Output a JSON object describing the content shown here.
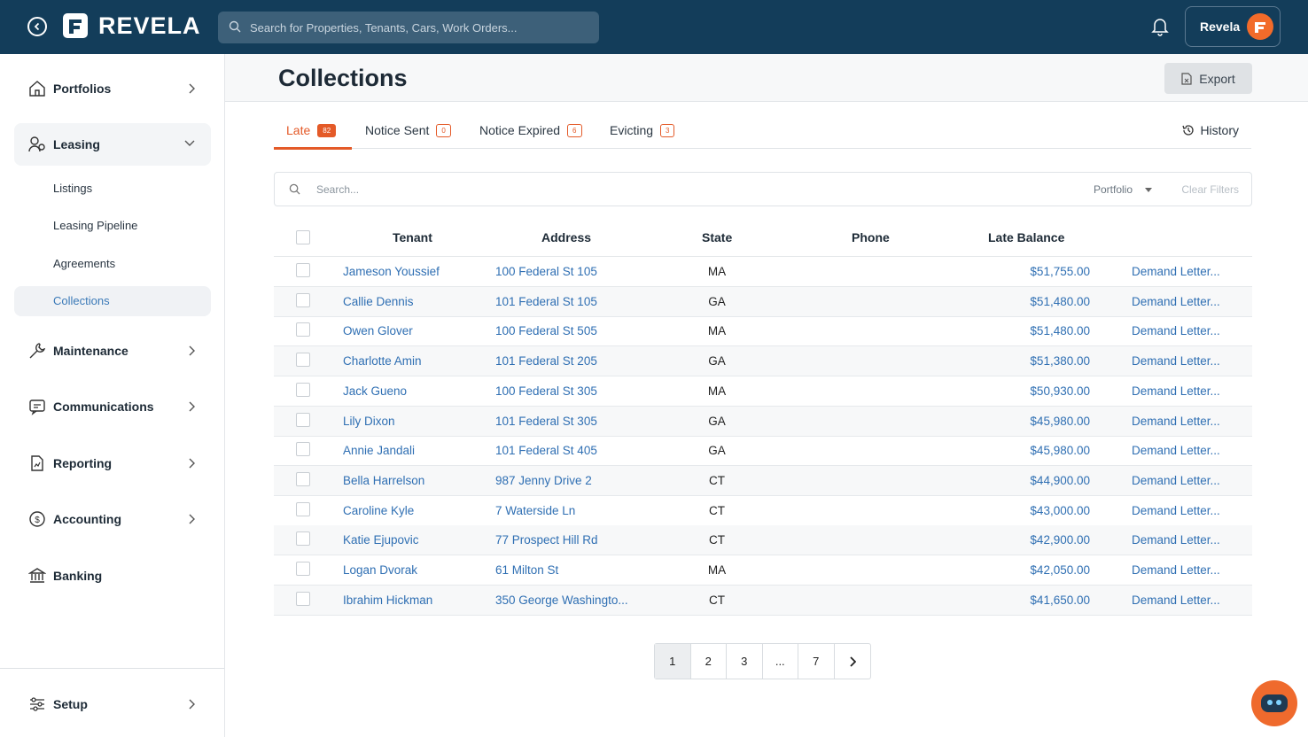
{
  "header": {
    "brand": "REVELA",
    "search_placeholder": "Search for Properties, Tenants, Cars, Work Orders...",
    "account_name": "Revela"
  },
  "sidebar": {
    "items": [
      {
        "label": "Portfolios",
        "icon": "home-icon"
      },
      {
        "label": "Leasing",
        "icon": "users-icon",
        "open": true
      },
      {
        "label": "Maintenance",
        "icon": "wrench-icon"
      },
      {
        "label": "Communications",
        "icon": "chat-icon"
      },
      {
        "label": "Reporting",
        "icon": "report-icon"
      },
      {
        "label": "Accounting",
        "icon": "dollar-icon"
      },
      {
        "label": "Banking",
        "icon": "bank-icon"
      }
    ],
    "leasing_sub": [
      "Listings",
      "Leasing Pipeline",
      "Agreements",
      "Collections"
    ],
    "active_sub": "Collections",
    "setup_label": "Setup"
  },
  "page": {
    "title": "Collections",
    "export_label": "Export",
    "history_label": "History"
  },
  "tabs": [
    {
      "label": "Late",
      "count": "82",
      "active": true
    },
    {
      "label": "Notice Sent",
      "count": "0"
    },
    {
      "label": "Notice Expired",
      "count": "6"
    },
    {
      "label": "Evicting",
      "count": "3"
    }
  ],
  "filters": {
    "search_placeholder": "Search...",
    "portfolio_label": "Portfolio",
    "clear_label": "Clear Filters"
  },
  "table": {
    "headers": [
      "Tenant",
      "Address",
      "State",
      "Phone",
      "Late Balance"
    ],
    "rows": [
      {
        "tenant": "Jameson Youssief",
        "address": "100 Federal St 105",
        "state": "MA",
        "phone": "",
        "balance": "$51,755.00",
        "action": "Demand Letter..."
      },
      {
        "tenant": "Callie Dennis",
        "address": "101 Federal St 105",
        "state": "GA",
        "phone": "",
        "balance": "$51,480.00",
        "action": "Demand Letter..."
      },
      {
        "tenant": "Owen Glover",
        "address": "100 Federal St 505",
        "state": "MA",
        "phone": "",
        "balance": "$51,480.00",
        "action": "Demand Letter..."
      },
      {
        "tenant": "Charlotte Amin",
        "address": "101 Federal St 205",
        "state": "GA",
        "phone": "",
        "balance": "$51,380.00",
        "action": "Demand Letter..."
      },
      {
        "tenant": "Jack Gueno",
        "address": "100 Federal St 305",
        "state": "MA",
        "phone": "",
        "balance": "$50,930.00",
        "action": "Demand Letter..."
      },
      {
        "tenant": "Lily Dixon",
        "address": "101 Federal St 305",
        "state": "GA",
        "phone": "",
        "balance": "$45,980.00",
        "action": "Demand Letter..."
      },
      {
        "tenant": "Annie Jandali",
        "address": "101 Federal St 405",
        "state": "GA",
        "phone": "",
        "balance": "$45,980.00",
        "action": "Demand Letter..."
      },
      {
        "tenant": "Bella Harrelson",
        "address": "987 Jenny Drive 2",
        "state": "CT",
        "phone": "",
        "balance": "$44,900.00",
        "action": "Demand Letter..."
      },
      {
        "tenant": "Caroline Kyle",
        "address": "7 Waterside Ln",
        "state": "CT",
        "phone": "",
        "balance": "$43,000.00",
        "action": "Demand Letter..."
      },
      {
        "tenant": "Katie Ejupovic",
        "address": "77 Prospect Hill Rd",
        "state": "CT",
        "phone": "",
        "balance": "$42,900.00",
        "action": "Demand Letter..."
      },
      {
        "tenant": "Logan Dvorak",
        "address": "61 Milton St",
        "state": "MA",
        "phone": "",
        "balance": "$42,050.00",
        "action": "Demand Letter..."
      },
      {
        "tenant": "Ibrahim Hickman",
        "address": "350 George Washingto...",
        "state": "CT",
        "phone": "",
        "balance": "$41,650.00",
        "action": "Demand Letter..."
      }
    ]
  },
  "pagination": {
    "pages": [
      "1",
      "2",
      "3",
      "...",
      "7"
    ],
    "current": "1"
  },
  "colors": {
    "header_bg": "#133d5a",
    "accent": "#e45a28",
    "link": "#2f6fb3"
  }
}
